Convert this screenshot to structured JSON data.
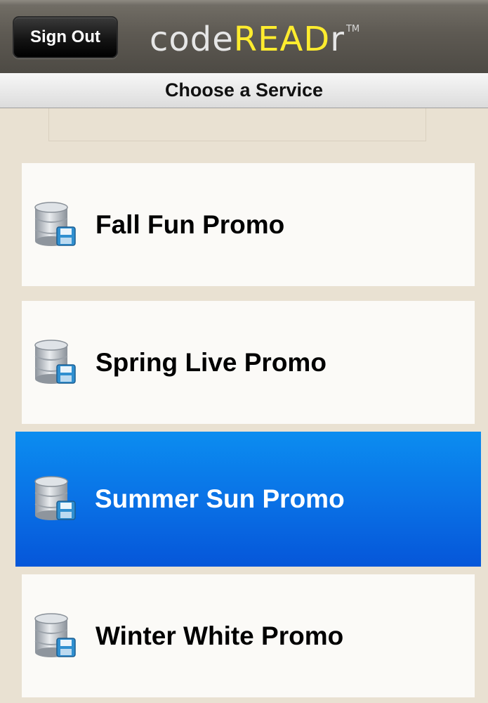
{
  "header": {
    "sign_out_label": "Sign Out",
    "logo": {
      "part1": "code",
      "part2": "READ",
      "part3": "r",
      "tm": "TM"
    }
  },
  "titlebar": {
    "title": "Choose a Service"
  },
  "services": [
    {
      "label": "Fall Fun Promo",
      "icon": "database-save-icon",
      "selected": false
    },
    {
      "label": "Spring Live Promo",
      "icon": "database-save-icon",
      "selected": false
    },
    {
      "label": "Summer Sun Promo",
      "icon": "database-save-icon",
      "selected": true
    },
    {
      "label": "Winter White Promo",
      "icon": "database-save-icon",
      "selected": false
    }
  ],
  "colors": {
    "background": "#e9e1d2",
    "selected_row": "#0a72e6",
    "logo_accent": "#ffec2e"
  }
}
